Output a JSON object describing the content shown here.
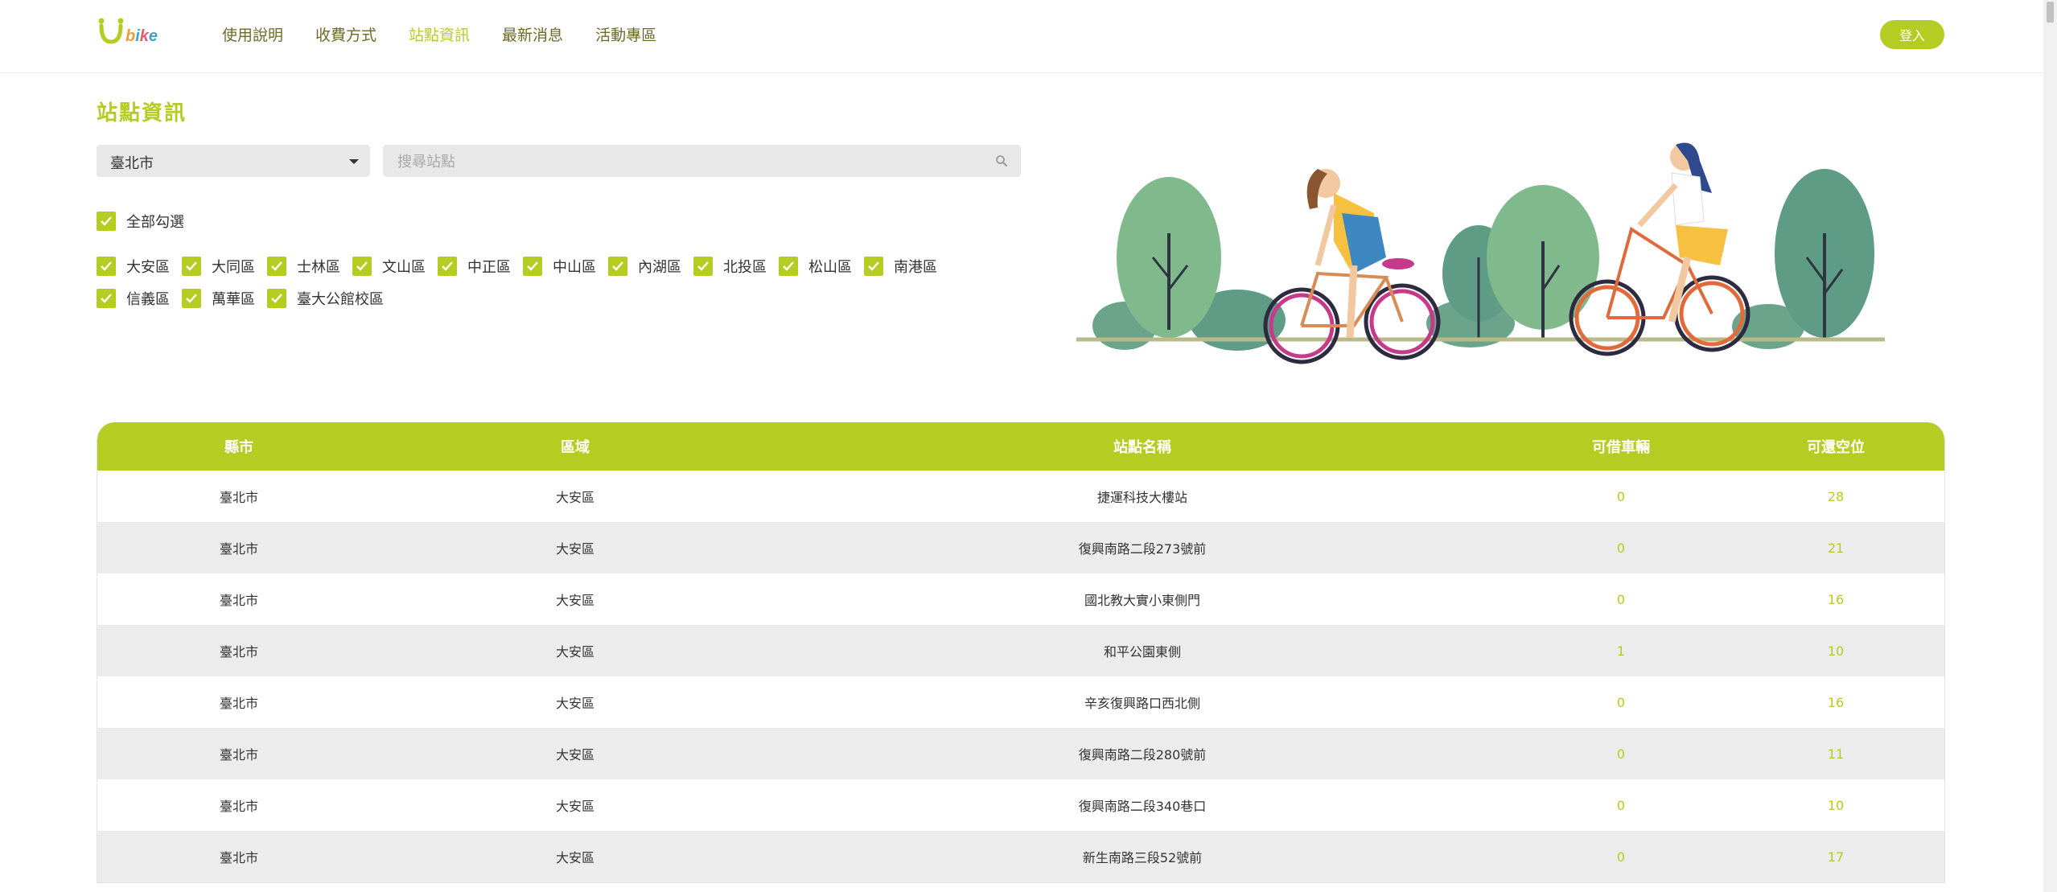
{
  "brand": {
    "logo_text": "bike",
    "accent": "#b5cc22"
  },
  "nav": {
    "items": [
      {
        "label": "使用說明"
      },
      {
        "label": "收費方式"
      },
      {
        "label": "站點資訊"
      },
      {
        "label": "最新消息"
      },
      {
        "label": "活動專區"
      }
    ],
    "active": "站點資訊",
    "login_label": "登入"
  },
  "page": {
    "title": "站點資訊"
  },
  "filter": {
    "city": "臺北市",
    "search_placeholder": "搜尋站點",
    "check_all_label": "全部勾選",
    "districts": [
      "大安區",
      "大同區",
      "士林區",
      "文山區",
      "中正區",
      "中山區",
      "內湖區",
      "北投區",
      "松山區",
      "南港區",
      "信義區",
      "萬華區",
      "臺大公館校區"
    ]
  },
  "table": {
    "headers": {
      "city": "縣市",
      "area": "區域",
      "name": "站點名稱",
      "available": "可借車輛",
      "empty": "可還空位"
    },
    "rows": [
      {
        "city": "臺北市",
        "area": "大安區",
        "name": "捷運科技大樓站",
        "available": "0",
        "empty": "28"
      },
      {
        "city": "臺北市",
        "area": "大安區",
        "name": "復興南路二段273號前",
        "available": "0",
        "empty": "21"
      },
      {
        "city": "臺北市",
        "area": "大安區",
        "name": "國北教大實小東側門",
        "available": "0",
        "empty": "16"
      },
      {
        "city": "臺北市",
        "area": "大安區",
        "name": "和平公園東側",
        "available": "1",
        "empty": "10"
      },
      {
        "city": "臺北市",
        "area": "大安區",
        "name": "辛亥復興路口西北側",
        "available": "0",
        "empty": "16"
      },
      {
        "city": "臺北市",
        "area": "大安區",
        "name": "復興南路二段280號前",
        "available": "0",
        "empty": "11"
      },
      {
        "city": "臺北市",
        "area": "大安區",
        "name": "復興南路二段340巷口",
        "available": "0",
        "empty": "10"
      },
      {
        "city": "臺北市",
        "area": "大安區",
        "name": "新生南路三段52號前",
        "available": "0",
        "empty": "17"
      }
    ]
  }
}
